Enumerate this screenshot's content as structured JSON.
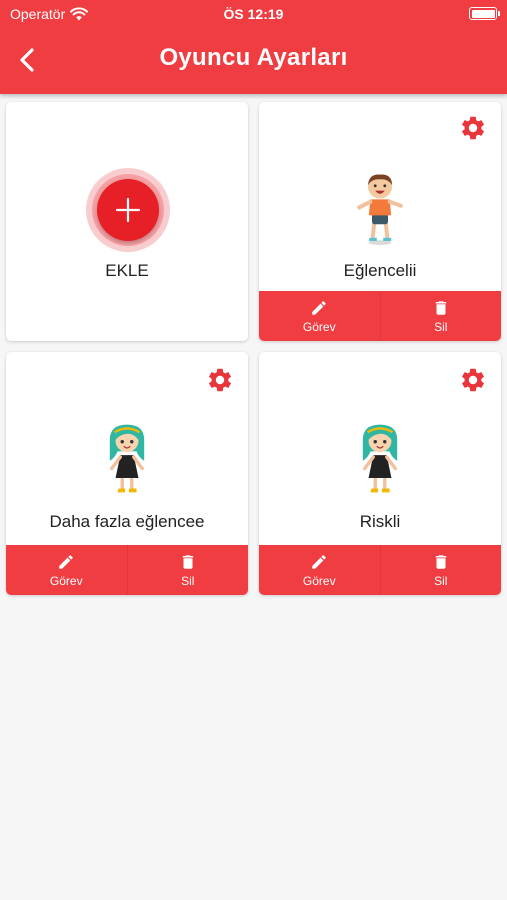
{
  "status_bar": {
    "carrier": "Operatör",
    "time": "ÖS 12:19"
  },
  "header": {
    "title": "Oyuncu Ayarları"
  },
  "add_card": {
    "label": "EKLE"
  },
  "players": [
    {
      "name": "Eğlencelii",
      "avatar": "boy-avatar"
    },
    {
      "name": "Daha fazla eğlencee",
      "avatar": "girl-avatar"
    },
    {
      "name": "Riskli",
      "avatar": "girl-avatar"
    }
  ],
  "actions": {
    "task_label": "Görev",
    "delete_label": "Sil"
  },
  "colors": {
    "primary": "#f03d42",
    "add_button": "#e71f26",
    "background": "#f6f6f6"
  }
}
